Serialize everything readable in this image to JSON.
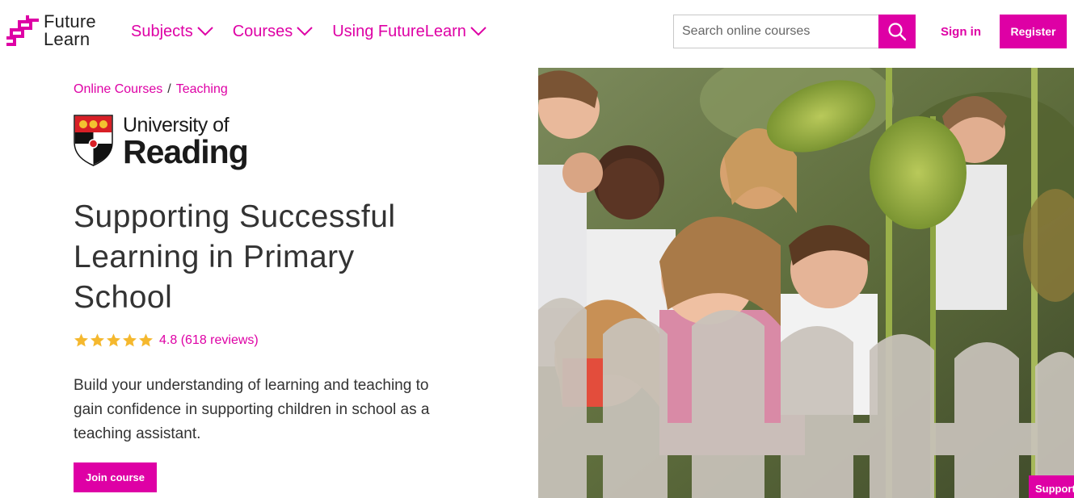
{
  "header": {
    "logo": {
      "line1": "Future",
      "line2": "Learn"
    },
    "nav": [
      {
        "label": "Subjects"
      },
      {
        "label": "Courses"
      },
      {
        "label": "Using FutureLearn"
      }
    ],
    "search": {
      "placeholder": "Search online courses",
      "value": ""
    },
    "sign_in": "Sign in",
    "register": "Register"
  },
  "breadcrumb": {
    "items": [
      "Online Courses",
      "Teaching"
    ],
    "separator": "/"
  },
  "university": {
    "line1": "University of",
    "line2": "Reading"
  },
  "course": {
    "title": "Supporting Successful Learning in Primary School",
    "rating_value": 4.8,
    "rating_text": "4.8 (618 reviews)",
    "stars": 5,
    "description": "Build your understanding of learning and teaching to gain confidence in supporting children in school as a teaching assistant.",
    "join_label": "Join course"
  },
  "support_tab": "Support",
  "colors": {
    "brand": "#de00a5",
    "star": "#f5b82e",
    "text": "#333333"
  }
}
